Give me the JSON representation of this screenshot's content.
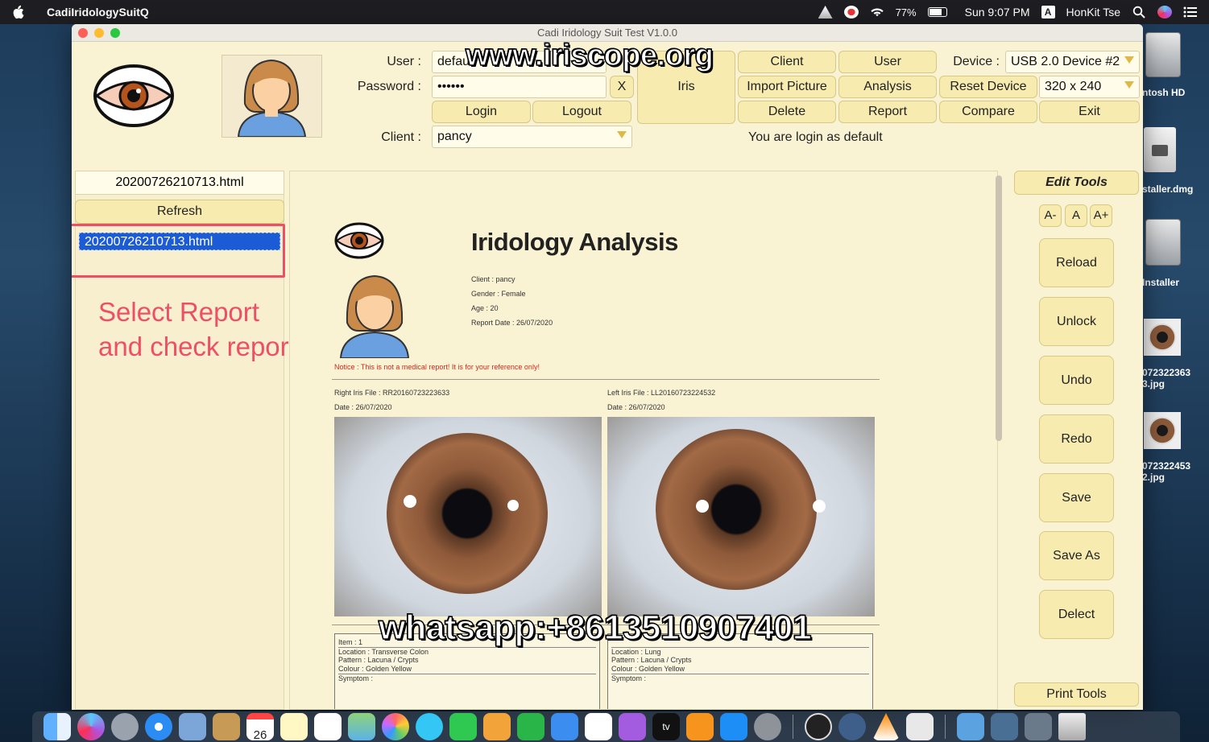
{
  "menubar": {
    "app_name": "CadiIridologySuitQ",
    "battery": "77%",
    "clock": "Sun 9:07 PM",
    "input_source": "A",
    "user": "HonKit Tse"
  },
  "desktop": {
    "items": [
      "ntosh HD",
      "staller.dmg",
      "Installer",
      "072322363 3.jpg",
      "072322453 2.jpg"
    ]
  },
  "window": {
    "title": "Cadi Iridology Suit Test V1.0.0"
  },
  "login": {
    "user_label": "User :",
    "user_value": "defau",
    "password_label": "Password :",
    "password_value": "••••••",
    "clear_label": "X",
    "login_label": "Login",
    "logout_label": "Logout",
    "client_label": "Client :",
    "client_value": "pancy"
  },
  "toolbar": {
    "iris": "Iris",
    "client": "Client",
    "user": "User",
    "import_picture": "Import Picture",
    "analysis": "Analysis",
    "reset_device": "Reset Device",
    "delete": "Delete",
    "report": "Report",
    "compare": "Compare",
    "exit": "Exit",
    "device_label": "Device :",
    "device_value": "USB 2.0 Device #2",
    "resolution_value": "320 x 240",
    "status": "You are login as default"
  },
  "left_panel": {
    "current_file": "20200726210713.html",
    "refresh": "Refresh",
    "selected_item": "20200726210713.html",
    "annotation_line1": "Select Report",
    "annotation_line2": "and check report"
  },
  "report": {
    "title": "Iridology Analysis",
    "client": "Client : pancy",
    "gender": "Gender : Female",
    "age": "Age : 20",
    "report_date": "Report Date : 26/07/2020",
    "notice": "Notice : This is not a medical report! It is for your reference only!",
    "right_file": "Right Iris File : RR20160723223633",
    "right_date": "Date : 26/07/2020",
    "left_file": "Left Iris File : LL20160723224532",
    "left_date": "Date : 26/07/2020",
    "item_no": "Item : 1",
    "right_location": "Location : Transverse Colon",
    "right_pattern": "Pattern : Lacuna / Crypts",
    "right_colour": "Colour : Golden Yellow",
    "right_symptom": "Symptom :",
    "left_location": "Location : Lung",
    "left_pattern": "Pattern : Lacuna / Crypts",
    "left_colour": "Colour : Golden Yellow",
    "left_symptom": "Symptom :"
  },
  "edit_tools": {
    "title": "Edit Tools",
    "font_smaller": "A-",
    "font_normal": "A",
    "font_larger": "A+",
    "reload": "Reload",
    "unlock": "Unlock",
    "undo": "Undo",
    "redo": "Redo",
    "save": "Save",
    "save_as": "Save As",
    "delect": "Delect",
    "print_tools": "Print Tools"
  },
  "watermarks": {
    "website": "www.iriscope.org",
    "whatsapp": "whatsapp:+8613510907401"
  },
  "dock": {
    "calendar_day": "26",
    "tv_label": "tv"
  },
  "colors": {
    "window_bg": "#faf3d3",
    "button_bg": "#f7ebb0",
    "annotation": "#ef4f65",
    "selection": "#1c5bd6",
    "notice": "#d0291c"
  }
}
